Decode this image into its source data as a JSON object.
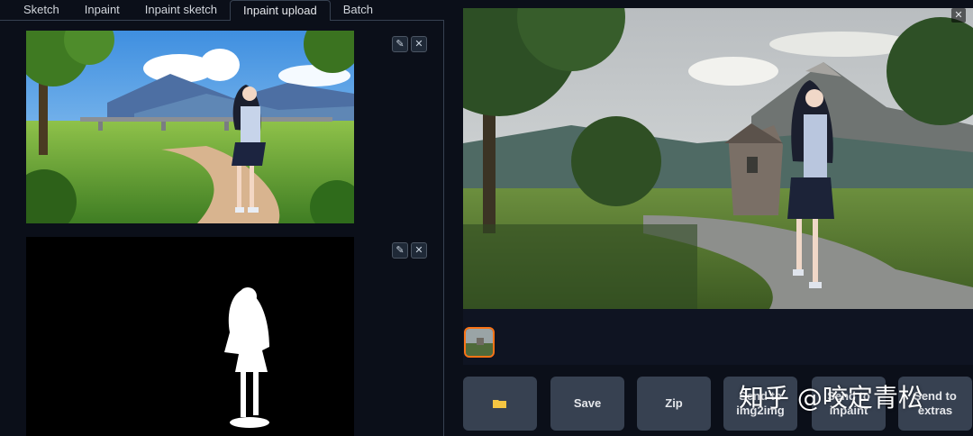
{
  "tabs": [
    {
      "label": "Sketch"
    },
    {
      "label": "Inpaint"
    },
    {
      "label": "Inpaint sketch"
    },
    {
      "label": "Inpaint upload",
      "active": true
    },
    {
      "label": "Batch"
    }
  ],
  "left": {
    "source_image": {
      "edit_icon": "pencil-icon",
      "clear_icon": "close-icon"
    },
    "mask_image": {
      "edit_icon": "pencil-icon",
      "clear_icon": "close-icon"
    }
  },
  "output": {
    "close_icon": "close-icon",
    "thumbnail_selected": true
  },
  "actions": [
    {
      "label": "",
      "icon": "folder-icon"
    },
    {
      "label": "Save"
    },
    {
      "label": "Zip"
    },
    {
      "label": "Send to img2img"
    },
    {
      "label": "Send to inpaint"
    },
    {
      "label": "Send to extras"
    }
  ],
  "watermark": "知乎 @咬定青松",
  "colors": {
    "accent": "#f97316",
    "background": "#0b0f19",
    "button": "#374151"
  }
}
